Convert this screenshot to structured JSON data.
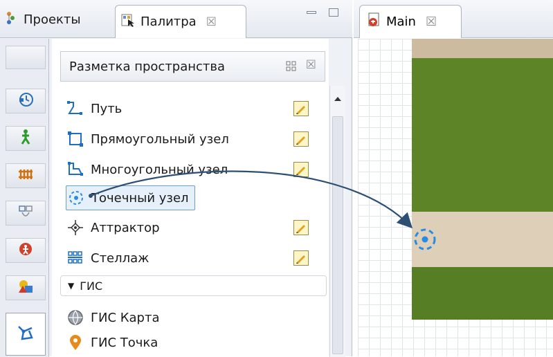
{
  "left_panel": {
    "tabs": [
      {
        "label": "Проекты",
        "icon": "projects-icon"
      },
      {
        "label": "Палитра",
        "icon": "palette-icon",
        "close": "☒"
      }
    ],
    "section": {
      "title": "Разметка пространства",
      "close": "☒"
    },
    "items": [
      {
        "label": "Путь",
        "icon": "path-icon",
        "editable": true
      },
      {
        "label": "Прямоугольный узел",
        "icon": "rect-node-icon",
        "editable": true
      },
      {
        "label": "Многоугольный узел",
        "icon": "polygon-node-icon",
        "editable": true
      },
      {
        "label": "Точечный узел",
        "icon": "point-node-icon",
        "editable": false,
        "selected": true
      },
      {
        "label": "Аттрактор",
        "icon": "attractor-icon",
        "editable": true
      },
      {
        "label": "Стеллаж",
        "icon": "rack-icon",
        "editable": true
      }
    ],
    "gis_group": {
      "title": "ГИС",
      "items": [
        {
          "label": "ГИС Карта",
          "icon": "gis-map-icon"
        },
        {
          "label": "ГИС Точка",
          "icon": "gis-point-icon"
        }
      ]
    }
  },
  "right_panel": {
    "tab": {
      "label": "Main",
      "close": "☒",
      "icon": "agent-main-icon"
    }
  },
  "colors": {
    "selection": "#e5f0fb",
    "accent": "#2f6fbf",
    "arrow": "#2c4f73",
    "point_node": "#2a8be6"
  }
}
